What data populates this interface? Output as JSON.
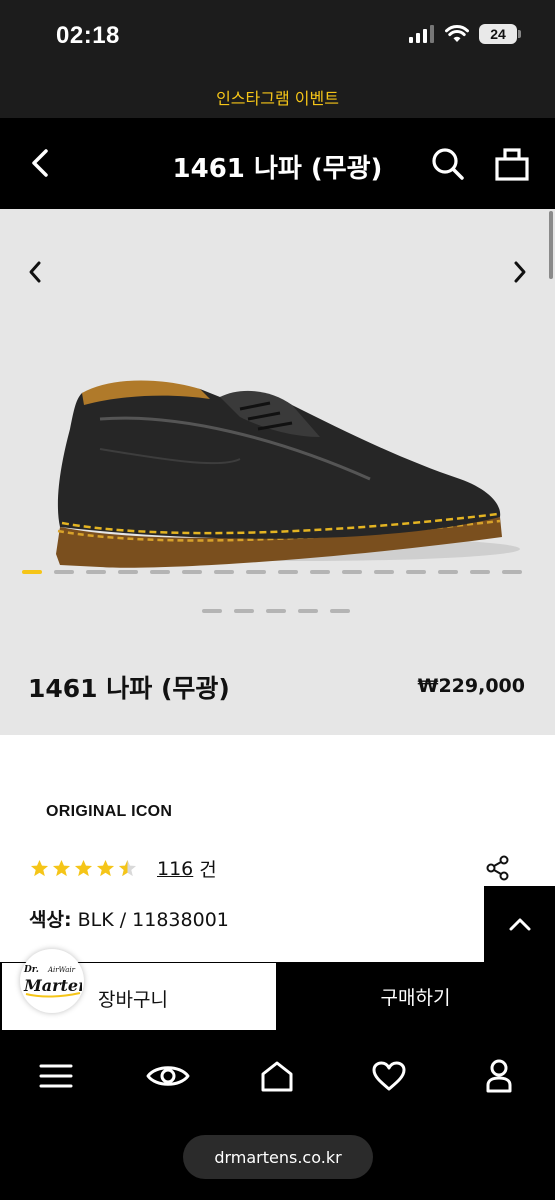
{
  "status_bar": {
    "time": "02:18",
    "battery": "24"
  },
  "promo_banner": {
    "text": "인스타그램 이벤트"
  },
  "header": {
    "title": "1461 나파 (무광)"
  },
  "product": {
    "name": "1461 나파 (무광)",
    "price": "₩229,000",
    "collection": "ORIGINAL ICON",
    "rating": 4.5,
    "review_count": "116",
    "review_unit": "건",
    "color_label": "색상:",
    "color_value": "BLK / 11838001"
  },
  "gallery": {
    "active_index": 0,
    "dot_count_row1": 16,
    "dot_count_row2": 5
  },
  "actions": {
    "cart_label": "장바구니",
    "buy_label": "구매하기"
  },
  "logo": {
    "line1": "Dr.",
    "line2": "AirWair",
    "line3": "Martens"
  },
  "footer": {
    "url": "drmartens.co.kr"
  },
  "colors": {
    "accent": "#f5c518",
    "dark": "#000000",
    "banner": "#1c1c1c",
    "gallery_bg": "#e6e6e6"
  },
  "icons": [
    "back-icon",
    "search-icon",
    "shopping-bag-icon",
    "chevron-left-icon",
    "chevron-right-icon",
    "share-icon",
    "chevron-up-icon",
    "menu-icon",
    "eye-icon",
    "home-icon",
    "heart-icon",
    "user-icon"
  ]
}
